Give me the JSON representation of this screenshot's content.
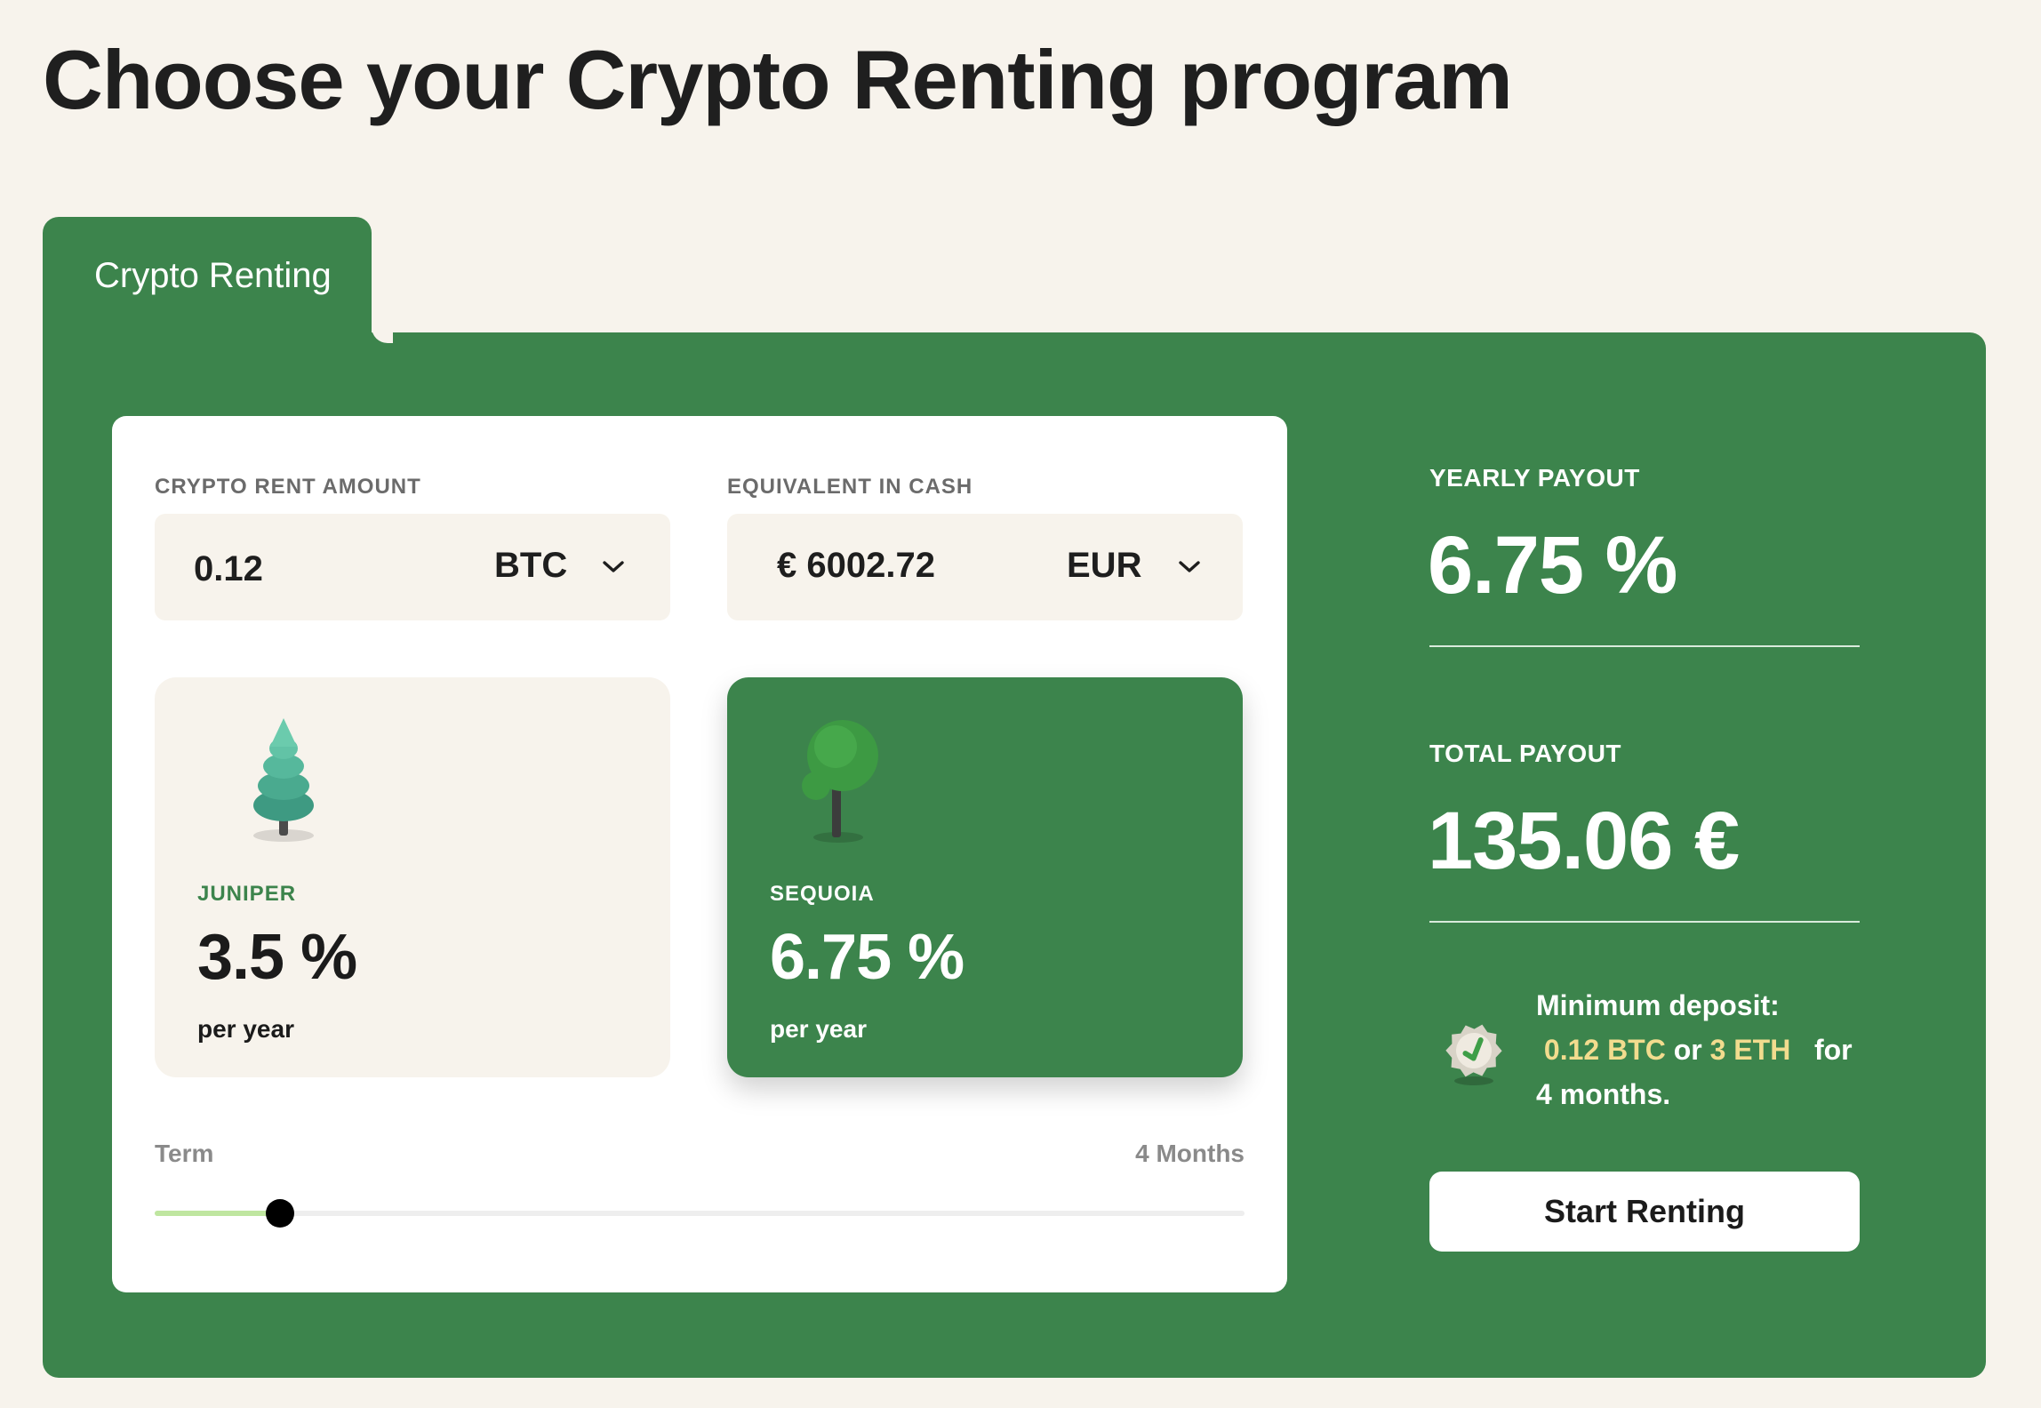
{
  "page": {
    "title": "Choose your Crypto Renting program"
  },
  "tab": {
    "label": "Crypto Renting"
  },
  "calculator": {
    "rent_amount": {
      "label": "CRYPTO RENT AMOUNT",
      "value": "0.12",
      "currency": "BTC"
    },
    "cash_equivalent": {
      "label": "EQUIVALENT IN CASH",
      "value": "€ 6002.72",
      "currency": "EUR"
    },
    "plans": [
      {
        "name": "JUNIPER",
        "rate": "3.5 %",
        "period": "per year",
        "icon": "pine-tree-icon",
        "selected": false
      },
      {
        "name": "SEQUOIA",
        "rate": "6.75 %",
        "period": "per year",
        "icon": "round-tree-icon",
        "selected": true
      }
    ],
    "term": {
      "label": "Term",
      "value": "4 Months",
      "slider_fraction": 0.115
    }
  },
  "summary": {
    "yearly": {
      "label": "YEARLY PAYOUT",
      "value": "6.75 %"
    },
    "total": {
      "label": "TOTAL PAYOUT",
      "value": "135.06 €"
    },
    "min_deposit": {
      "intro": "Minimum deposit:",
      "btc": "0.12 BTC",
      "or": "or",
      "eth": "3 ETH",
      "for": "for",
      "duration": "4 months.",
      "icon": "verified-badge-icon"
    },
    "cta": "Start Renting"
  },
  "colors": {
    "brand_green": "#3c844c",
    "background": "#f7f3ec",
    "highlight": "#f2dc8e",
    "slider_fill": "#bfe6a0"
  }
}
